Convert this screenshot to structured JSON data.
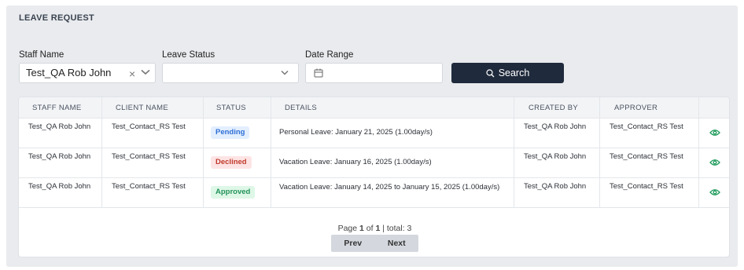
{
  "page": {
    "title": "LEAVE REQUEST"
  },
  "filters": {
    "staff_label": "Staff Name",
    "staff_value": "Test_QA Rob John",
    "status_label": "Leave Status",
    "status_value": "",
    "date_label": "Date Range",
    "date_value": "",
    "search_label": "Search"
  },
  "table": {
    "columns": [
      "STAFF NAME",
      "CLIENT NAME",
      "STATUS",
      "DETAILS",
      "CREATED BY",
      "APPROVER"
    ],
    "rows": [
      {
        "staff": "Test_QA Rob John",
        "client": "Test_Contact_RS Test",
        "status": "Pending",
        "details": "Personal Leave: January 21, 2025 (1.00day/s)",
        "created_by": "Test_QA Rob John",
        "approver": "Test_Contact_RS Test"
      },
      {
        "staff": "Test_QA Rob John",
        "client": "Test_Contact_RS Test",
        "status": "Declined",
        "details": "Vacation Leave: January 16, 2025 (1.00day/s)",
        "created_by": "Test_QA Rob John",
        "approver": "Test_Contact_RS Test"
      },
      {
        "staff": "Test_QA Rob John",
        "client": "Test_Contact_RS Test",
        "status": "Approved",
        "details": "Vacation Leave: January 14, 2025 to January 15, 2025 (1.00day/s)",
        "created_by": "Test_QA Rob John",
        "approver": "Test_Contact_RS Test"
      }
    ]
  },
  "pagination": {
    "page_prefix": "Page ",
    "current": "1",
    "of": " of ",
    "total_pages": "1",
    "total_text": " | total: 3",
    "prev_label": "Prev",
    "next_label": "Next"
  },
  "colors": {
    "primary_button": "#1f2a3c",
    "pending": "#2f6fd6",
    "declined": "#c0392b",
    "approved": "#23935a",
    "view_icon": "#1e9a5a"
  },
  "icons": {
    "clear": "close-icon",
    "dropdown": "chevron-down-icon",
    "calendar": "calendar-icon",
    "search": "search-icon",
    "view": "eye-icon"
  }
}
